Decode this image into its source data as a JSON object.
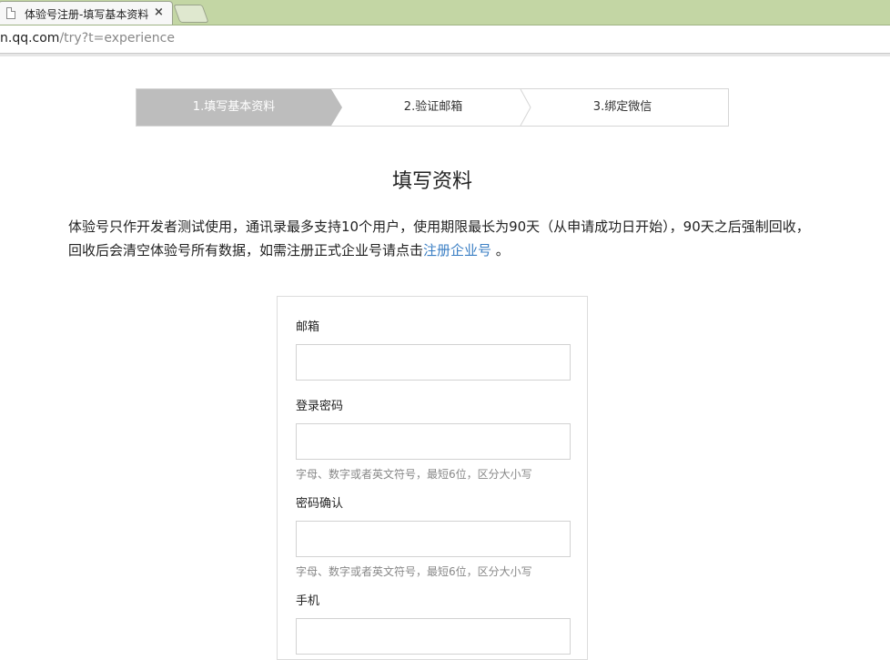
{
  "browser": {
    "tab_title": "体验号注册-填写基本资料",
    "tab_close": "×",
    "address_host": "n.qq.com",
    "address_path": "/try?t=experience"
  },
  "steps": [
    {
      "label": "1.填写基本资料",
      "active": true
    },
    {
      "label": "2.验证邮箱",
      "active": false
    },
    {
      "label": "3.绑定微信",
      "active": false
    }
  ],
  "page": {
    "title": "填写资料",
    "notice_text": "体验号只作开发者测试使用，通讯录最多支持10个用户，使用期限最长为90天（从申请成功日开始），90天之后强制回收，回收后会清空体验号所有数据，如需注册正式企业号请点击",
    "notice_link": "注册企业号",
    "notice_end": " 。"
  },
  "form": {
    "email": {
      "label": "邮箱",
      "value": "",
      "placeholder": ""
    },
    "password": {
      "label": "登录密码",
      "value": "",
      "placeholder": "",
      "hint": "字母、数字或者英文符号，最短6位，区分大小写"
    },
    "password_confirm": {
      "label": "密码确认",
      "value": "",
      "placeholder": "",
      "hint": "字母、数字或者英文符号，最短6位，区分大小写"
    },
    "phone": {
      "label": "手机",
      "value": "",
      "placeholder": ""
    }
  },
  "colors": {
    "active_step_bg": "#bdbdbd",
    "link": "#3b7fc4",
    "tabstrip": "#c3d6a4"
  }
}
